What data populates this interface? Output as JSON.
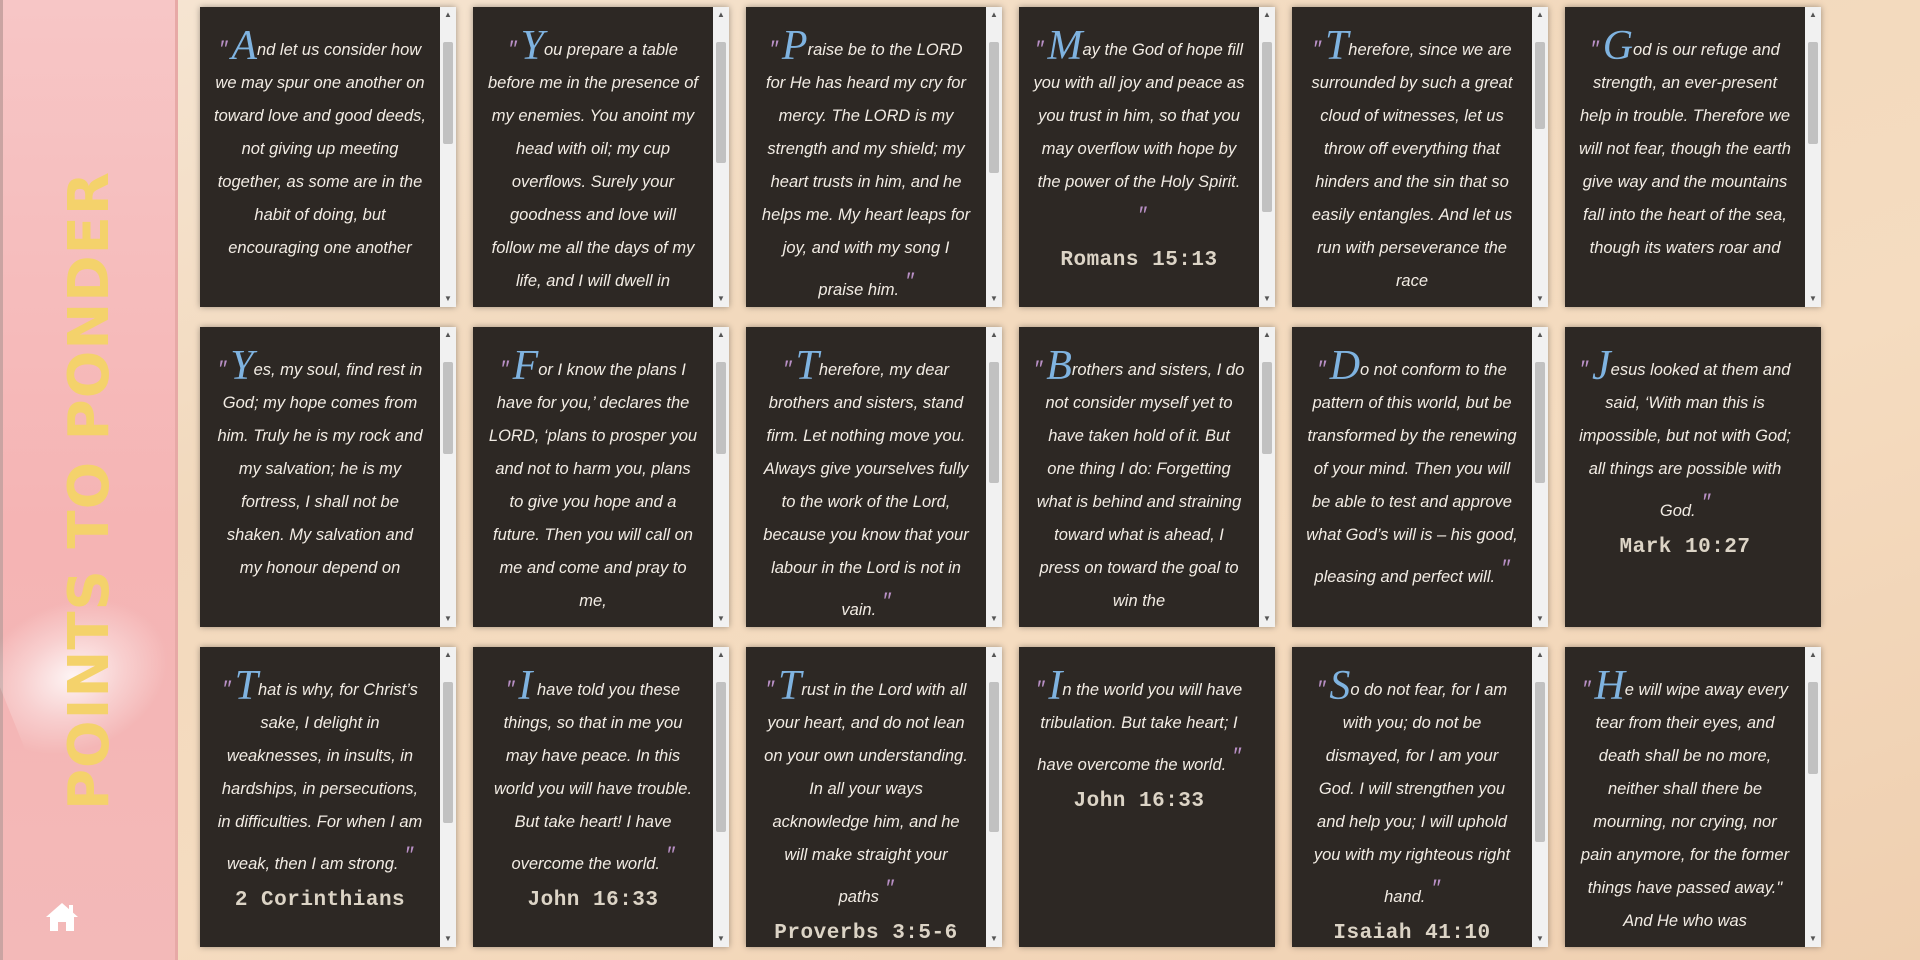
{
  "sidebar": {
    "title": "POINTS TO PONDER",
    "home_icon": "home-icon"
  },
  "colors": {
    "card_background": "#2d2824",
    "verse_text": "#f2ece4",
    "dropcap": "#7fb3e0",
    "quote_marks": "#b990c6",
    "reference": "#dcd4c6",
    "brand_title": "#f4d26b",
    "sidebar": "#f5b4b4"
  },
  "cards": [
    {
      "cap": "A",
      "text": "nd let us consider how we may spur one another on toward love and good deeds, not giving up meeting together, as some are in the habit of doing, but encouraging one another",
      "close": "",
      "ref": "",
      "thumb": [
        0.07,
        0.6
      ]
    },
    {
      "cap": "Y",
      "text": "ou prepare a table before me in the presence of my enemies. You anoint my head with oil; my cup overflows. Surely your goodness and love will follow me all the days of my life, and I will dwell in",
      "close": "",
      "ref": "",
      "thumb": [
        0.07,
        0.7
      ]
    },
    {
      "cap": "P",
      "text": "raise be to the LORD for He has heard my cry for mercy. The LORD is my strength and my shield; my heart trusts in him, and he helps me. My heart leaps for joy, and with my song I praise him.",
      "close": "″",
      "ref": "",
      "thumb": [
        0.07,
        0.75
      ]
    },
    {
      "cap": "M",
      "text": "ay the God of hope fill you with all joy and peace as you trust in him, so that you may overflow with hope by the power of the Holy Spirit.",
      "close": "″",
      "ref": "Romans 15:13",
      "thumb": [
        0.07,
        0.95
      ]
    },
    {
      "cap": "T",
      "text": "herefore, since we are surrounded by such a great cloud of witnesses, let us throw off everything that hinders and the sin that so easily entangles. And let us run with perseverance the race",
      "close": "",
      "ref": "",
      "thumb": [
        0.07,
        0.52
      ]
    },
    {
      "cap": "G",
      "text": "od is our refuge and strength, an ever-present help in trouble. Therefore we will not fear, though the earth give way and the mountains fall into the heart of the sea, though its waters roar and",
      "close": "",
      "ref": "",
      "thumb": [
        0.07,
        0.6
      ]
    },
    {
      "cap": "Y",
      "text": "es, my soul, find rest in God; my hope comes from him. Truly he is my rock and my salvation; he is my fortress, I shall not be shaken. My salvation and my honour depend on",
      "close": "",
      "ref": "",
      "thumb": [
        0.07,
        0.55
      ]
    },
    {
      "cap": "F",
      "text": "or I know the plans I have for you,’ declares the LORD, ‘plans to prosper you and not to harm you, plans to give you hope and a future. Then you will call on me and come and pray to me,",
      "close": "",
      "ref": "",
      "thumb": [
        0.07,
        0.55
      ]
    },
    {
      "cap": "T",
      "text": "herefore, my dear brothers and sisters, stand firm. Let nothing move you. Always give yourselves fully to the work of the Lord, because you know that your labour in the Lord is not in vain.",
      "close": "″",
      "ref": "",
      "thumb": [
        0.07,
        0.7
      ]
    },
    {
      "cap": "B",
      "text": "rothers and sisters, I do not consider myself yet to have taken hold of it. But one thing I do: Forgetting what is behind and straining toward what is ahead, I press on toward the goal to win the",
      "close": "",
      "ref": "",
      "thumb": [
        0.07,
        0.55
      ]
    },
    {
      "cap": "D",
      "text": "o not conform to the pattern of this world, but be transformed by the renewing of your mind. Then you will be able to test and approve what God’s will is – his good, pleasing and perfect will.",
      "close": "″",
      "ref": "",
      "thumb": [
        0.07,
        0.7
      ]
    },
    {
      "cap": "J",
      "text": "esus looked at them and said, ‘With man this is impossible, but not with God; all things are possible with God.",
      "close": "″",
      "ref": "Mark 10:27",
      "thumb": null
    },
    {
      "cap": "T",
      "text": "hat is why, for Christ’s sake, I delight in weaknesses, in insults, in hardships, in persecutions, in difficulties. For when I am weak, then I am strong.",
      "close": "″",
      "ref": "2 Corinthians",
      "thumb": [
        0.07,
        0.8
      ]
    },
    {
      "cap": "I",
      "text": " have told you these things, so that in me you may have peace. In this world you will have trouble. But take heart! I have overcome the world.",
      "close": "″",
      "ref": "John 16:33",
      "thumb": [
        0.07,
        0.85
      ]
    },
    {
      "cap": "T",
      "text": "rust in the Lord with all your heart, and do not lean on your own understanding. In all your ways acknowledge him, and he will make straight your paths",
      "close": "″",
      "ref": "Proverbs 3:5-6",
      "thumb": [
        0.07,
        0.85
      ]
    },
    {
      "cap": "I",
      "text": "n the world you will have tribulation. But take heart; I have overcome the world.",
      "close": "″",
      "ref": "John 16:33",
      "thumb": null
    },
    {
      "cap": "S",
      "text": "o do not fear, for I am with you; do not be dismayed, for I am your God. I will strengthen you and help you; I will uphold you with my righteous right hand.",
      "close": "″",
      "ref": "Isaiah 41:10",
      "thumb": [
        0.07,
        0.9
      ]
    },
    {
      "cap": "H",
      "text": "e will wipe away every tear from their eyes, and death shall be no more, neither shall there be mourning, nor crying, nor pain anymore, for the former things have passed away.\" And He who was",
      "close": "",
      "ref": "",
      "thumb": [
        0.07,
        0.55
      ]
    }
  ]
}
